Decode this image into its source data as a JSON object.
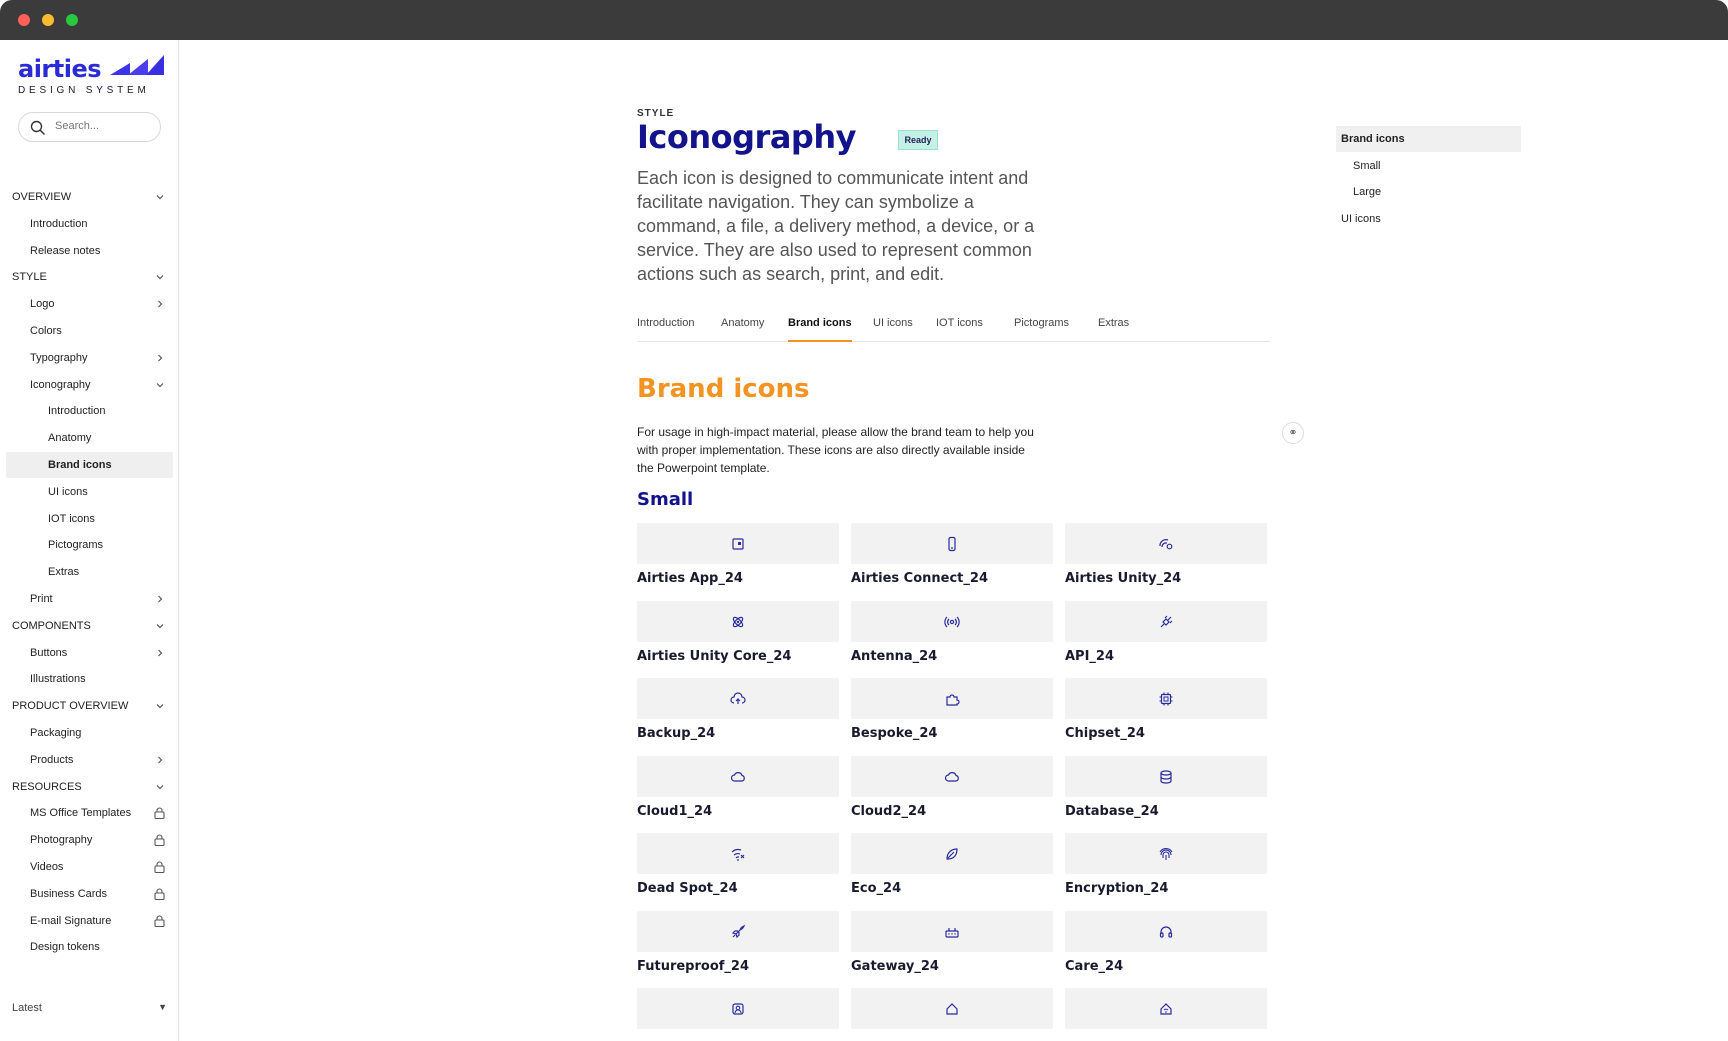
{
  "brand": {
    "logo_word": "airties",
    "logo_sub": "DESIGN SYSTEM",
    "accent": "#2b2bd6",
    "orange": "#f29322",
    "navy": "#13138c"
  },
  "search": {
    "placeholder": "Search..."
  },
  "sidebar": {
    "items": [
      {
        "label": "OVERVIEW",
        "level": 0,
        "icon": "chevron-down-icon"
      },
      {
        "label": "Introduction",
        "level": 1
      },
      {
        "label": "Release notes",
        "level": 1
      },
      {
        "label": "STYLE",
        "level": 0,
        "icon": "chevron-down-icon"
      },
      {
        "label": "Logo",
        "level": 1,
        "icon": "chevron-right-icon"
      },
      {
        "label": "Colors",
        "level": 1
      },
      {
        "label": "Typography",
        "level": 1,
        "icon": "chevron-right-icon"
      },
      {
        "label": "Iconography",
        "level": 1,
        "icon": "chevron-down-icon"
      },
      {
        "label": "Introduction",
        "level": 2
      },
      {
        "label": "Anatomy",
        "level": 2
      },
      {
        "label": "Brand icons",
        "level": 2,
        "selected": true
      },
      {
        "label": "UI icons",
        "level": 2
      },
      {
        "label": "IOT icons",
        "level": 2
      },
      {
        "label": "Pictograms",
        "level": 2
      },
      {
        "label": "Extras",
        "level": 2
      },
      {
        "label": "Print",
        "level": 1,
        "icon": "chevron-right-icon"
      },
      {
        "label": "COMPONENTS",
        "level": 0,
        "icon": "chevron-down-icon"
      },
      {
        "label": "Buttons",
        "level": 1,
        "icon": "chevron-right-icon"
      },
      {
        "label": "Illustrations",
        "level": 1
      },
      {
        "label": "PRODUCT OVERVIEW",
        "level": 0,
        "icon": "chevron-down-icon"
      },
      {
        "label": "Packaging",
        "level": 1
      },
      {
        "label": "Products",
        "level": 1,
        "icon": "chevron-right-icon"
      },
      {
        "label": "RESOURCES",
        "level": 0,
        "icon": "chevron-down-icon"
      },
      {
        "label": "MS Office Templates",
        "level": 1,
        "icon": "lock-icon"
      },
      {
        "label": "Photography",
        "level": 1,
        "icon": "lock-icon"
      },
      {
        "label": "Videos",
        "level": 1,
        "icon": "lock-icon"
      },
      {
        "label": "Business Cards",
        "level": 1,
        "icon": "lock-icon"
      },
      {
        "label": "E-mail Signature",
        "level": 1,
        "icon": "lock-icon"
      },
      {
        "label": "Design tokens",
        "level": 1
      }
    ],
    "version": "Latest"
  },
  "page": {
    "kicker": "STYLE",
    "title": "Iconography",
    "badge": "Ready",
    "lead": "Each icon is designed to communicate intent and facilitate navigation. They can symbolize a command, a file, a delivery method, a device, or a service. They are also used to represent common actions such as search, print, and edit.",
    "tabs": [
      "Introduction",
      "Anatomy",
      "Brand icons",
      "UI icons",
      "IOT icons",
      "Pictograms",
      "Extras"
    ],
    "active_tab": "Brand icons",
    "section_title": "Brand icons",
    "section_text": "For usage in high-impact material, please allow the brand team to help you with proper implementation. These icons are also directly available inside the Powerpoint template.",
    "subsection": "Small",
    "icons": [
      {
        "name": "Airties App_24",
        "icon": "app-icon"
      },
      {
        "name": "Airties Connect_24",
        "icon": "phone-icon"
      },
      {
        "name": "Airties Unity_24",
        "icon": "unity-icon"
      },
      {
        "name": "Airties Unity Core_24",
        "icon": "atom-icon"
      },
      {
        "name": "Antenna_24",
        "icon": "antenna-icon"
      },
      {
        "name": "API_24",
        "icon": "plug-icon"
      },
      {
        "name": "Backup_24",
        "icon": "cloud-upload-icon"
      },
      {
        "name": "Bespoke_24",
        "icon": "puzzle-icon"
      },
      {
        "name": "Chipset_24",
        "icon": "chip-icon"
      },
      {
        "name": "Cloud1_24",
        "icon": "cloud-icon"
      },
      {
        "name": "Cloud2_24",
        "icon": "cloud-icon"
      },
      {
        "name": "Database_24",
        "icon": "database-icon"
      },
      {
        "name": "Dead Spot_24",
        "icon": "wifi-off-icon"
      },
      {
        "name": "Eco_24",
        "icon": "leaf-icon"
      },
      {
        "name": "Encryption_24",
        "icon": "fingerprint-icon"
      },
      {
        "name": "Futureproof_24",
        "icon": "rocket-icon"
      },
      {
        "name": "Gateway_24",
        "icon": "router-icon"
      },
      {
        "name": "Care_24",
        "icon": "headset-icon"
      },
      {
        "name": "",
        "icon": "home-user-icon"
      },
      {
        "name": "",
        "icon": "home-icon"
      },
      {
        "name": "",
        "icon": "home-wifi-icon"
      }
    ]
  },
  "toc": {
    "items": [
      {
        "label": "Brand icons",
        "level": 0,
        "active": true
      },
      {
        "label": "Small",
        "level": 1
      },
      {
        "label": "Large",
        "level": 1
      },
      {
        "label": "UI icons",
        "level": 0
      }
    ]
  }
}
